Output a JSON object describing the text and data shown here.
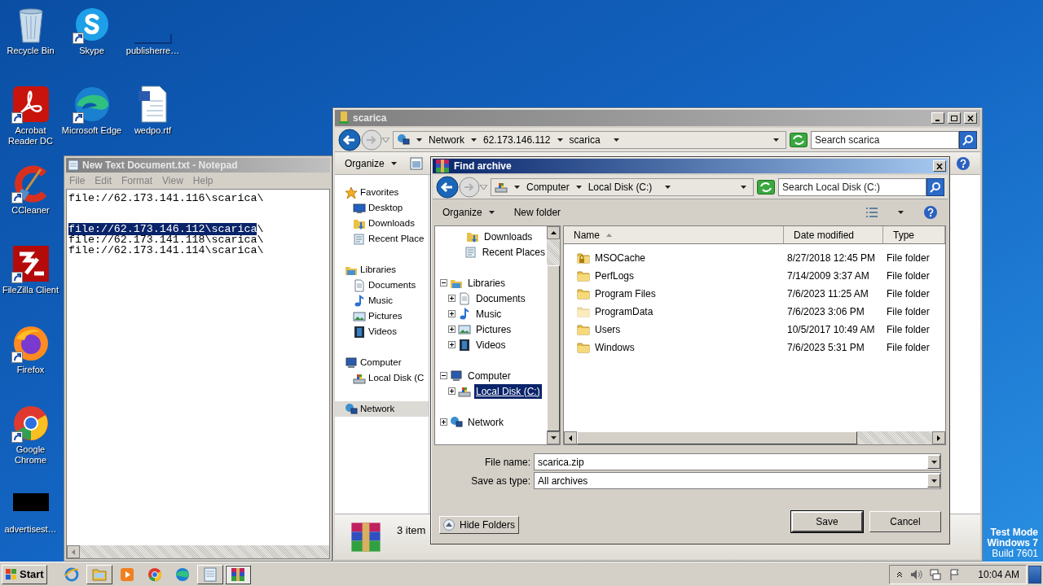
{
  "desktop": {
    "columns": [
      [
        {
          "label": "Recycle Bin",
          "kind": "recycle",
          "shortcut": false
        },
        {
          "label": "Acrobat Reader DC",
          "kind": "acrobat",
          "shortcut": true
        },
        {
          "label": "CCleaner",
          "kind": "ccleaner",
          "shortcut": true
        },
        {
          "label": "FileZilla Client",
          "kind": "filezilla",
          "shortcut": true
        },
        {
          "label": "Firefox",
          "kind": "firefox",
          "shortcut": true
        },
        {
          "label": "Google Chrome",
          "kind": "chrome",
          "shortcut": true
        },
        {
          "label": "advertisest…",
          "kind": "thumbnail",
          "shortcut": false
        }
      ],
      [
        {
          "label": "Skype",
          "kind": "skype",
          "shortcut": true
        },
        {
          "label": "Microsoft Edge",
          "kind": "edge",
          "shortcut": true
        }
      ],
      [
        {
          "label": "publisherre…",
          "kind": "blank",
          "shortcut": false
        },
        {
          "label": "wedpo.rtf",
          "kind": "document",
          "shortcut": false
        }
      ]
    ],
    "system_text": [
      "Test Mode",
      "Windows 7",
      "Build 7601"
    ]
  },
  "notepad": {
    "title": "New Text Document.txt - Notepad",
    "menu": [
      "File",
      "Edit",
      "Format",
      "View",
      "Help"
    ],
    "lines": [
      {
        "kind": "text",
        "text": "file://62.173.141.116\\scarica\\"
      },
      {
        "kind": "blank"
      },
      {
        "kind": "text",
        "selected_text": "file://62.173.146.112\\scarica",
        "text": "\\"
      },
      {
        "kind": "text",
        "text": "file://62.173.141.118\\scarica\\"
      },
      {
        "kind": "text",
        "text": "file://62.173.141.114\\scarica\\"
      }
    ]
  },
  "explorer": {
    "title": "scarica",
    "breadcrumb": [
      "Network",
      "62.173.146.112",
      "scarica"
    ],
    "search_placeholder": "Search scarica",
    "toolbar": [
      "Organize"
    ],
    "nav": [
      {
        "label": "Favorites",
        "kind": "favorites",
        "selected": false,
        "children": [
          {
            "label": "Desktop",
            "kind": "desktop",
            "selected": false
          },
          {
            "label": "Downloads",
            "kind": "downloads",
            "selected": false
          },
          {
            "label": "Recent Place",
            "kind": "recent",
            "selected": false
          }
        ]
      },
      {
        "label": "Libraries",
        "kind": "libraries",
        "selected": false,
        "children": [
          {
            "label": "Documents",
            "kind": "documents",
            "selected": false
          },
          {
            "label": "Music",
            "kind": "music",
            "selected": false
          },
          {
            "label": "Pictures",
            "kind": "pictures",
            "selected": false
          },
          {
            "label": "Videos",
            "kind": "videos",
            "selected": false
          }
        ]
      },
      {
        "label": "Computer",
        "kind": "computer",
        "selected": false,
        "children": [
          {
            "label": "Local Disk (C",
            "kind": "disk",
            "selected": false
          }
        ]
      },
      {
        "label": "Network",
        "kind": "network",
        "selected": true
      }
    ],
    "details": "3 item"
  },
  "dialog": {
    "title": "Find archive",
    "breadcrumb": [
      "Computer",
      "Local Disk (C:)"
    ],
    "search_placeholder": "Search Local Disk (C:)",
    "toolbar": [
      "Organize",
      "New folder"
    ],
    "tree": [
      {
        "children": [
          {
            "label": "Downloads",
            "kind": "downloads",
            "selected": false
          },
          {
            "label": "Recent Places",
            "kind": "recent",
            "selected": false
          }
        ]
      },
      {
        "label": "Libraries",
        "kind": "libraries",
        "selected": false,
        "expanded": true,
        "children": [
          {
            "label": "Documents",
            "kind": "documents",
            "selected": false,
            "expanded": false
          },
          {
            "label": "Music",
            "kind": "music",
            "selected": false,
            "expanded": false
          },
          {
            "label": "Pictures",
            "kind": "pictures",
            "selected": false,
            "expanded": false
          },
          {
            "label": "Videos",
            "kind": "videos",
            "selected": false,
            "expanded": false
          }
        ]
      },
      {
        "label": "Computer",
        "kind": "computer",
        "selected": false,
        "expanded": true,
        "children": [
          {
            "label": "Local Disk (C:)",
            "kind": "disk",
            "selected": true,
            "expanded": false
          }
        ]
      },
      {
        "label": "Network",
        "kind": "network",
        "selected": false,
        "expanded": false
      }
    ],
    "columns": [
      {
        "label": "Name",
        "sorted": true
      },
      {
        "label": "Date modified",
        "sorted": false
      },
      {
        "label": "Type",
        "sorted": false
      }
    ],
    "rows": [
      {
        "name": "MSOCache",
        "date": "8/27/2018 12:45 PM",
        "type": "File folder",
        "kind": "locked"
      },
      {
        "name": "PerfLogs",
        "date": "7/14/2009 3:37 AM",
        "type": "File folder",
        "kind": "folder"
      },
      {
        "name": "Program Files",
        "date": "7/6/2023 11:25 AM",
        "type": "File folder",
        "kind": "folder"
      },
      {
        "name": "ProgramData",
        "date": "7/6/2023 3:06 PM",
        "type": "File folder",
        "kind": "hidden"
      },
      {
        "name": "Users",
        "date": "10/5/2017 10:49 AM",
        "type": "File folder",
        "kind": "folder"
      },
      {
        "name": "Windows",
        "date": "7/6/2023 5:31 PM",
        "type": "File folder",
        "kind": "folder"
      }
    ],
    "fields": [
      {
        "label": "File name:",
        "value": "scarica.zip"
      },
      {
        "label": "Save as type:",
        "value": "All archives"
      }
    ],
    "hide_folders": "Hide Folders",
    "buttons": [
      {
        "label": "Save",
        "default": true
      },
      {
        "label": "Cancel",
        "default": false
      }
    ]
  },
  "taskbar": {
    "start": "Start",
    "apps": [
      {
        "kind": "ie",
        "running": false,
        "focused": false
      },
      {
        "kind": "explorer",
        "running": true,
        "focused": false
      },
      {
        "kind": "media",
        "running": false,
        "focused": false
      },
      {
        "kind": "chrome",
        "running": false,
        "focused": false
      },
      {
        "kind": "edge",
        "running": false,
        "focused": false
      },
      {
        "kind": "notepad",
        "running": true,
        "focused": false
      },
      {
        "kind": "winrar",
        "running": true,
        "focused": true
      }
    ],
    "clock": "10:04 AM"
  }
}
